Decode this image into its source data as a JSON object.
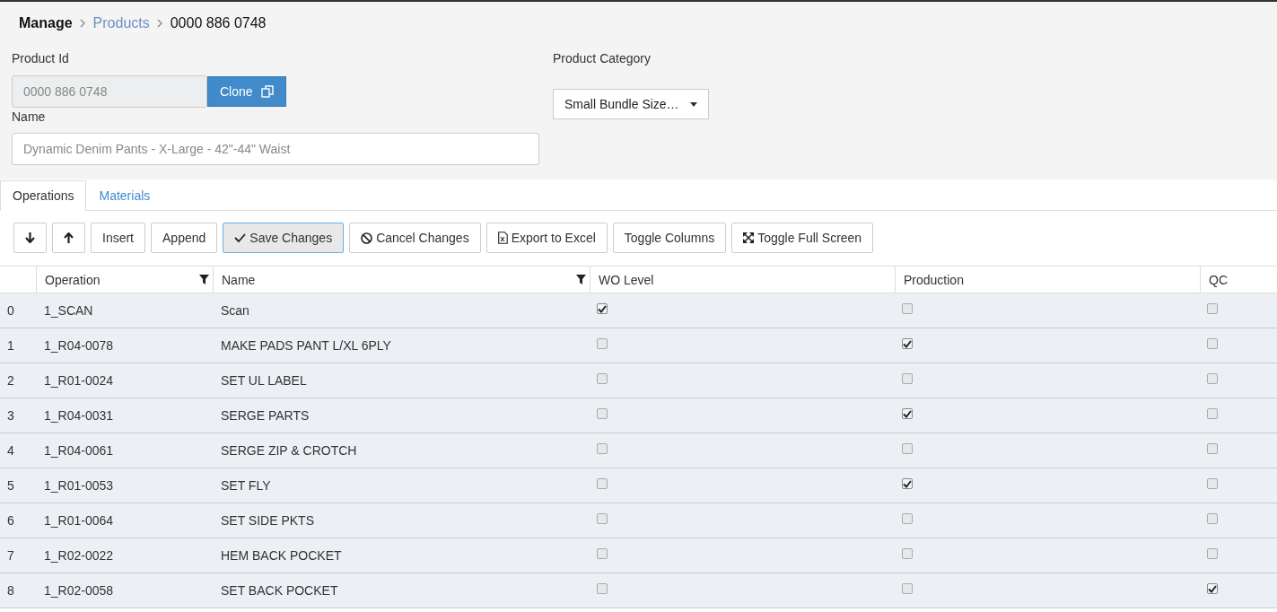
{
  "breadcrumb": [
    {
      "label": "Manage",
      "kind": "root"
    },
    {
      "label": "Products",
      "kind": "link"
    },
    {
      "label": "0000 886 0748",
      "kind": "current"
    }
  ],
  "product_id": {
    "label": "Product Id",
    "value": "0000 886 0748",
    "disabled": true
  },
  "clone_button": {
    "label": "Clone"
  },
  "name": {
    "label": "Name",
    "placeholder": "Dynamic Denim Pants - X-Large - 42\"-44\" Waist"
  },
  "product_category": {
    "label": "Product Category",
    "value": "Small Bundle Size…"
  },
  "tabs": [
    {
      "label": "Operations",
      "selected": true
    },
    {
      "label": "Materials",
      "selected": false
    }
  ],
  "toolbar": [
    {
      "kind": "down",
      "focused": false
    },
    {
      "kind": "up",
      "focused": false
    },
    {
      "kind": "text",
      "label": "Insert",
      "focused": false
    },
    {
      "kind": "text",
      "label": "Append",
      "focused": false
    },
    {
      "kind": "check",
      "label": "Save Changes",
      "focused": true
    },
    {
      "kind": "cancel",
      "label": "Cancel Changes",
      "focused": false
    },
    {
      "kind": "excel",
      "label": "Export to Excel",
      "focused": false
    },
    {
      "kind": "text",
      "label": "Toggle Columns",
      "focused": false
    },
    {
      "kind": "fullscreen",
      "label": "Toggle Full Screen",
      "focused": false
    }
  ],
  "table": {
    "columns": [
      {
        "label": "Operation",
        "filter": true
      },
      {
        "label": "Name",
        "filter": true
      },
      {
        "label": "WO Level",
        "filter": false
      },
      {
        "label": "Production",
        "filter": false
      },
      {
        "label": "QC",
        "filter": false
      }
    ],
    "rows": [
      {
        "index": "0",
        "operation": "1_SCAN",
        "name": "Scan",
        "wo_level": true,
        "production": false,
        "qc": false
      },
      {
        "index": "1",
        "operation": "1_R04-0078",
        "name": "MAKE PADS PANT L/XL 6PLY",
        "wo_level": false,
        "production": true,
        "qc": false
      },
      {
        "index": "2",
        "operation": "1_R01-0024",
        "name": "SET UL LABEL",
        "wo_level": false,
        "production": false,
        "qc": false
      },
      {
        "index": "3",
        "operation": "1_R04-0031",
        "name": "SERGE PARTS",
        "wo_level": false,
        "production": true,
        "qc": false
      },
      {
        "index": "4",
        "operation": "1_R04-0061",
        "name": "SERGE ZIP & CROTCH",
        "wo_level": false,
        "production": false,
        "qc": false
      },
      {
        "index": "5",
        "operation": "1_R01-0053",
        "name": "SET FLY",
        "wo_level": false,
        "production": true,
        "qc": false
      },
      {
        "index": "6",
        "operation": "1_R01-0064",
        "name": "SET SIDE PKTS",
        "wo_level": false,
        "production": false,
        "qc": false
      },
      {
        "index": "7",
        "operation": "1_R02-0022",
        "name": "HEM BACK POCKET",
        "wo_level": false,
        "production": false,
        "qc": false
      },
      {
        "index": "8",
        "operation": "1_R02-0058",
        "name": "SET BACK POCKET",
        "wo_level": false,
        "production": false,
        "qc": true
      }
    ]
  }
}
